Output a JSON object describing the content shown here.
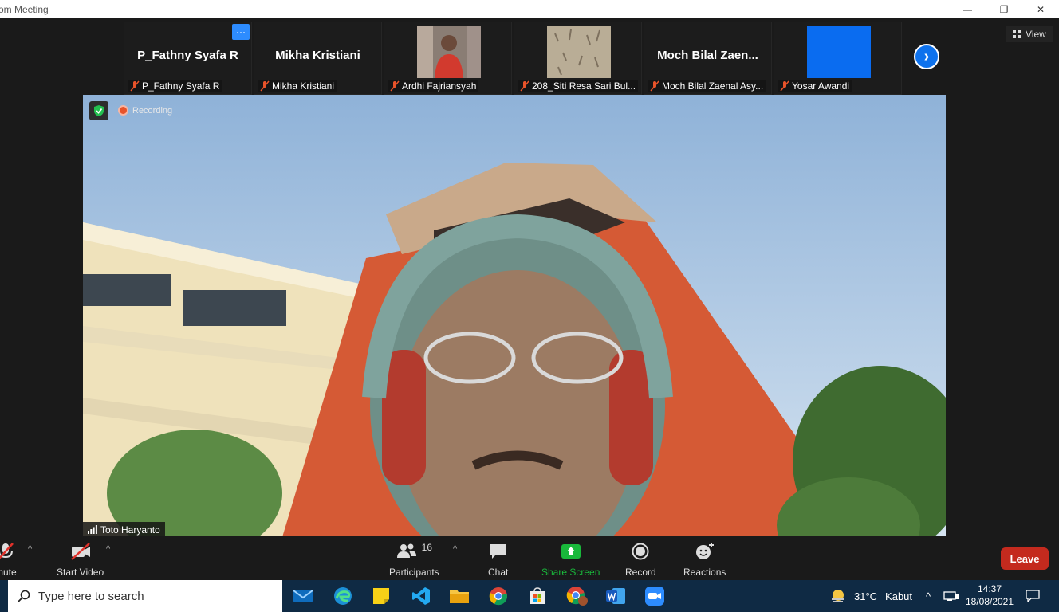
{
  "window": {
    "title": "om Meeting",
    "minimize_glyph": "—",
    "restore_glyph": "❐",
    "close_glyph": "✕"
  },
  "thumbnails": [
    {
      "display": "P_Fathny Syafa R",
      "label": "P_Fathny Syafa R",
      "has_more": true,
      "more_glyph": "···"
    },
    {
      "display": "Mikha Kristiani",
      "label": "Mikha Kristiani"
    },
    {
      "display": "",
      "label": "Ardhi Fajriansyah",
      "avatar": "red-shirt-photo"
    },
    {
      "display": "",
      "label": "208_Siti Resa Sari Bul...",
      "avatar": "beige-texture-photo"
    },
    {
      "display": "Moch Bilal Zaen...",
      "label": "Moch Bilal Zaenal Asy..."
    },
    {
      "display": "",
      "label": "Yosar Awandi",
      "avatar": "blue-square"
    }
  ],
  "view_button": "View",
  "next_glyph": "›",
  "main_video": {
    "recording_label": "Recording",
    "speaker": "Toto Haryanto"
  },
  "toolbar": {
    "mute": "mute",
    "start_video": "Start Video",
    "participants": "Participants",
    "participants_count": "16",
    "chat": "Chat",
    "share_screen": "Share Screen",
    "record": "Record",
    "reactions": "Reactions",
    "leave": "Leave",
    "caret_glyph": "^"
  },
  "taskbar": {
    "search_placeholder": "Type here to search",
    "weather_temp": "31°C",
    "weather_text": "Kabut",
    "time": "14:37",
    "date": "18/08/2021",
    "tray_caret": "^"
  },
  "colors": {
    "zoom_blue": "#2d8cff",
    "leave_red": "#c42a1e",
    "share_green": "#19b83b",
    "taskbar": "#0f2a44"
  }
}
